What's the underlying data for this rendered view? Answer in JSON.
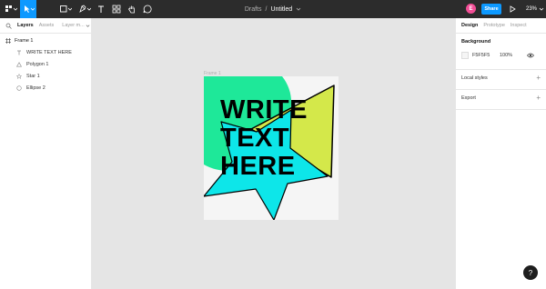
{
  "toolbar": {
    "breadcrumb_folder": "Drafts",
    "breadcrumb_sep": "/",
    "document_title": "Untitled",
    "avatar_initial": "E",
    "share_label": "Share",
    "zoom_level": "23%"
  },
  "left_panel": {
    "tabs": {
      "layers": "Layers",
      "assets": "Assets",
      "pages": "Layer m..."
    },
    "frame_name": "Frame 1",
    "layers": [
      {
        "name": "WRITE TEXT HERE",
        "icon": "text-icon"
      },
      {
        "name": "Polygon 1",
        "icon": "polygon-icon"
      },
      {
        "name": "Star 1",
        "icon": "star-icon"
      },
      {
        "name": "Ellipse 2",
        "icon": "ellipse-icon"
      }
    ]
  },
  "canvas": {
    "frame_label": "Frame 1",
    "frame_text": "WRITE\nTEXT\nHERE",
    "colors": {
      "ellipse": "#1ee899",
      "star": "#0de6e9",
      "triangle": "#d4e84a",
      "frame_bg": "#f5f5f5"
    }
  },
  "right_panel": {
    "tabs": {
      "design": "Design",
      "prototype": "Prototype",
      "inspect": "Inspect"
    },
    "background_title": "Background",
    "background_hex": "F5F5F5",
    "background_opacity": "100%",
    "local_styles_title": "Local styles",
    "export_title": "Export"
  },
  "help_label": "?"
}
